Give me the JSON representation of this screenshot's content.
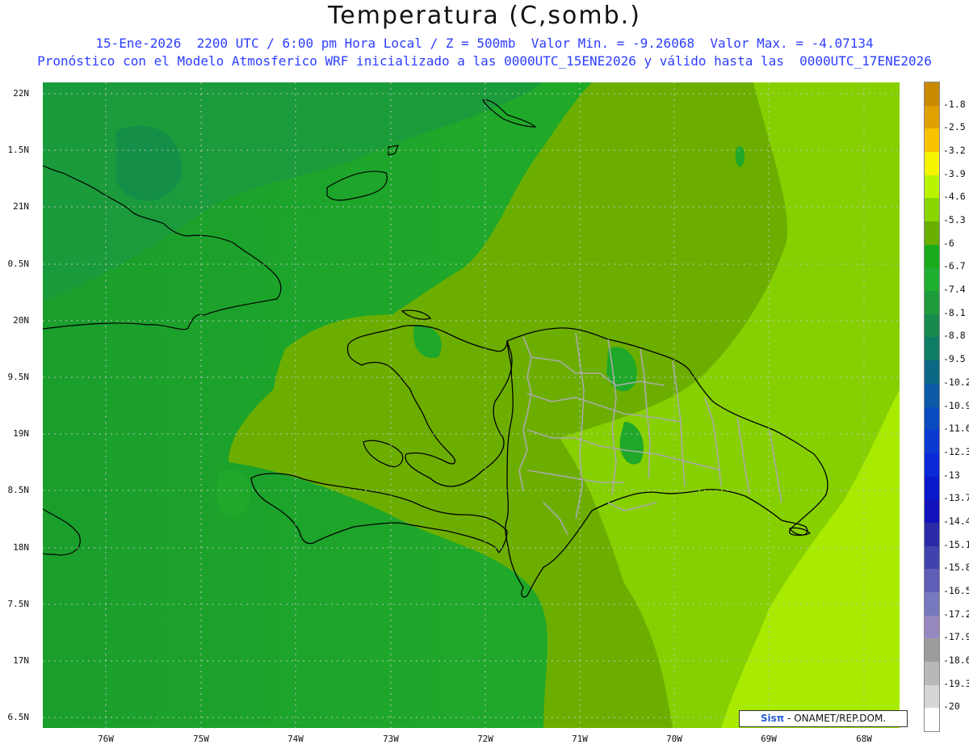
{
  "title": "Temperatura (C,somb.)",
  "subtitle_line1": "15-Ene-2026  2200 UTC / 6:00 pm Hora Local / Z = 500mb  Valor Min. = -9.26068  Valor Max. = -4.07134",
  "subtitle_line2": "Pronóstico con el Modelo Atmosferico WRF inicializado a las 0000UTC_15ENE2026 y válido hasta las  0000UTC_17ENE2026",
  "lat_labels": [
    "22N",
    "1.5N",
    "21N",
    "0.5N",
    "20N",
    "9.5N",
    "19N",
    "8.5N",
    "18N",
    "7.5N",
    "17N",
    "6.5N"
  ],
  "lon_labels": [
    "76W",
    "75W",
    "74W",
    "73W",
    "72W",
    "71W",
    "70W",
    "69W",
    "68W"
  ],
  "colorbar": {
    "labels": [
      "-1.8",
      "-2.5",
      "-3.2",
      "-3.9",
      "-4.6",
      "-5.3",
      "-6",
      "-6.7",
      "-7.4",
      "-8.1",
      "-8.8",
      "-9.5",
      "-10.2",
      "-10.9",
      "-11.6",
      "-12.3",
      "-13",
      "-13.7",
      "-14.4",
      "-15.1",
      "-15.8",
      "-16.5",
      "-17.2",
      "-17.9",
      "-18.6",
      "-19.3",
      "-20"
    ],
    "colors": [
      "#c98a00",
      "#e0a000",
      "#f7c200",
      "#f7f400",
      "#b8f400",
      "#8ad600",
      "#6aae00",
      "#1aac1a",
      "#20b030",
      "#1e9c3a",
      "#178a4c",
      "#0f7c66",
      "#0a6a86",
      "#0a5aa6",
      "#0a4ac0",
      "#0a3ad2",
      "#0a28d8",
      "#0a18cc",
      "#1212bc",
      "#2a2aa8",
      "#4242ae",
      "#5e5eb6",
      "#7878be",
      "#9888c0",
      "#9c9c9c",
      "#b8b8b8",
      "#d6d6d6",
      "#ffffff"
    ]
  },
  "credit": {
    "brand": "Sisπ",
    "text": " - ONAMET/REP.DOM."
  }
}
